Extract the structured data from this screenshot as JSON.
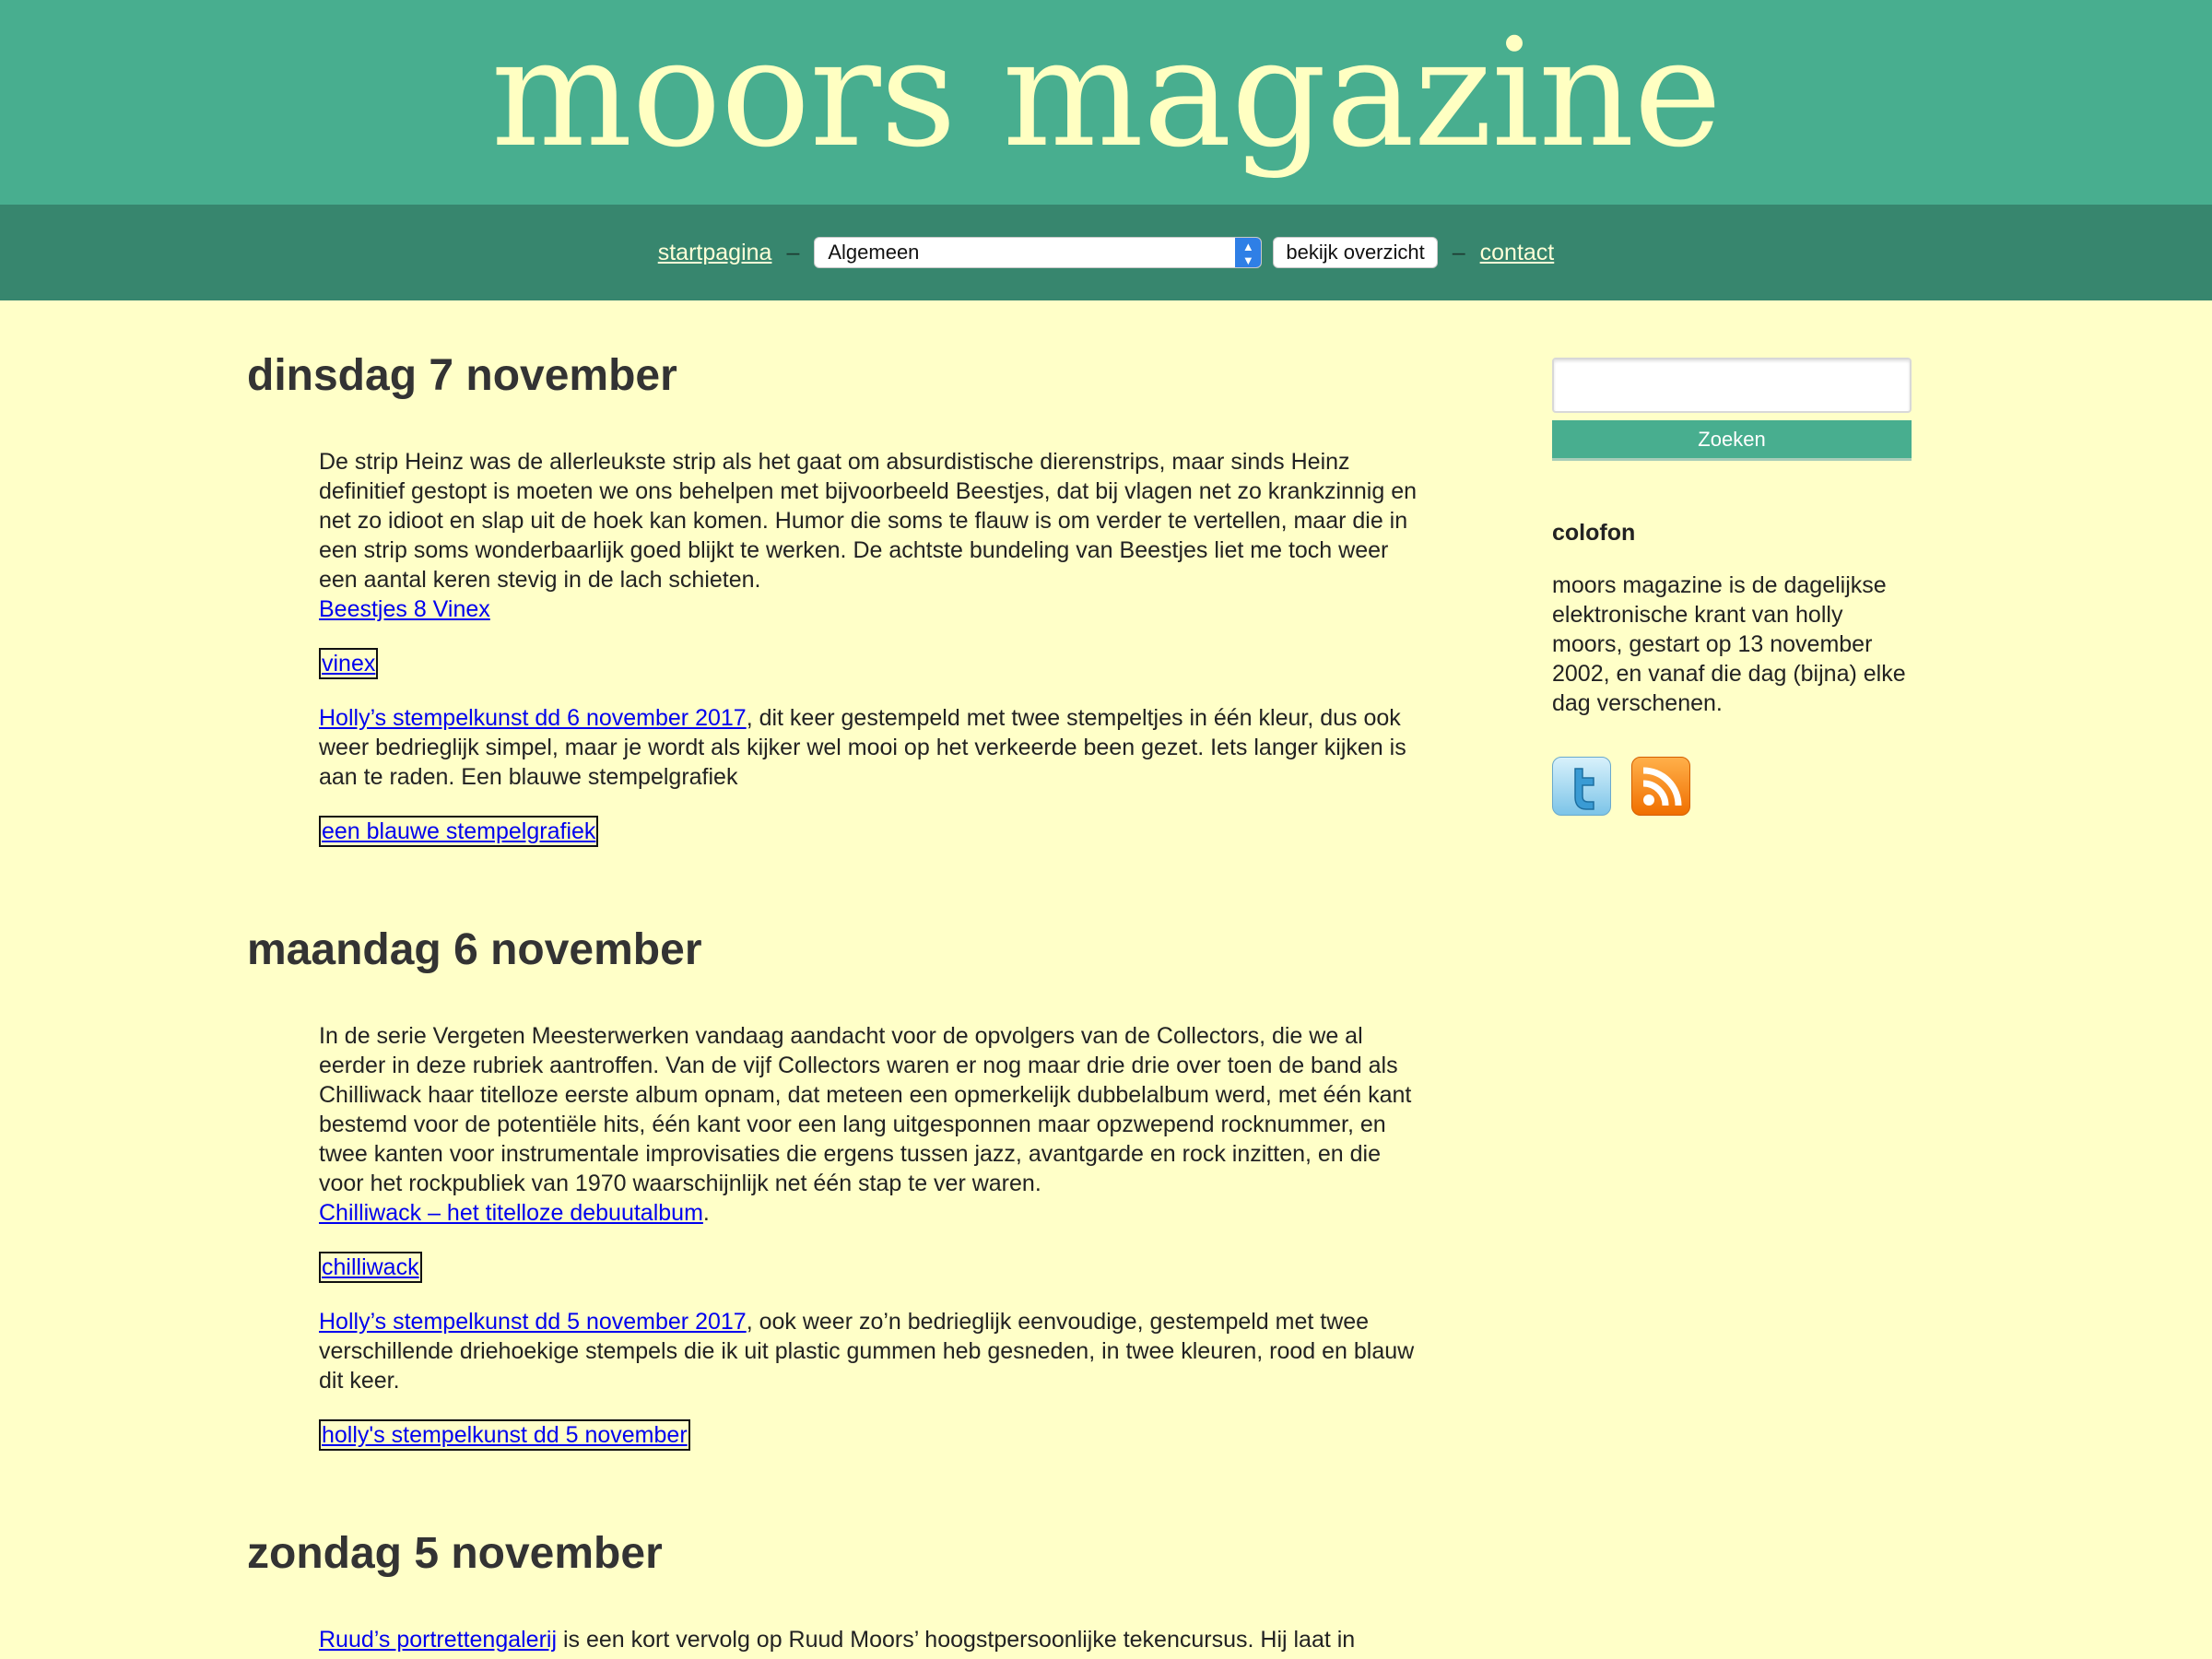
{
  "header": {
    "title": "moors magazine"
  },
  "nav": {
    "home": "startpagina",
    "dash": "–",
    "category_selected": "Algemeen",
    "overview_button": "bekijk overzicht",
    "contact": "contact"
  },
  "days": [
    {
      "date": "dinsdag 7 november",
      "p1": "De strip Heinz was de allerleukste strip als het gaat om absurdistische dierenstrips, maar sinds Heinz definitief gestopt is moeten we ons behelpen met bijvoorbeeld Beestjes, dat bij vlagen net zo krankzinnig en net zo idioot en slap uit de hoek kan komen. Humor die soms te flauw is om verder te vertellen, maar die in een strip soms wonderbaarlijk goed blijkt te werken. De achtste bundeling van Beestjes liet me toch weer een aantal keren stevig in de lach schieten.",
      "p1_link": "Beestjes 8 Vinex",
      "img1_label": "vinex",
      "p2_link": "Holly’s stempelkunst dd 6 november 2017",
      "p2_text": ", dit keer gestempeld met twee stempeltjes in één kleur, dus ook weer bedrieglijk simpel, maar je wordt als kijker wel mooi op het verkeerde been gezet. Iets langer kijken is aan te raden. Een blauwe stempelgrafiek",
      "img2_label": "een blauwe stempelgrafiek"
    },
    {
      "date": "maandag 6 november",
      "p1": "In de serie Vergeten Meesterwerken vandaag aandacht voor de opvolgers van de Collectors, die we al eerder in deze rubriek aantroffen. Van de vijf Collectors waren er nog maar drie drie over toen de band als Chilliwack haar titelloze eerste album opnam, dat meteen een opmerkelijk dubbelalbum werd, met één kant bestemd voor de potentiële hits, één kant voor een lang uitgesponnen maar opzwepend rocknummer, en twee kanten voor instrumentale improvisaties die ergens tussen jazz, avantgarde en rock inzitten, en die voor het rockpubliek van 1970 waarschijnlijk net één stap te ver waren.",
      "p1_link": "Chilliwack – het titelloze debuutalbum",
      "p1_link_suffix": ".",
      "img1_label": "chilliwack",
      "p2_link": "Holly’s stempelkunst dd 5 november 2017",
      "p2_text": ", ook weer zo’n bedrieglijk eenvoudige, gestempeld met twee verschillende driehoekige stempels die ik uit plastic gummen heb gesneden, in twee kleuren, rood en blauw dit keer.",
      "img2_label": "holly's stempelkunst dd 5 november"
    },
    {
      "date": "zondag 5 november",
      "p1_link": "Ruud’s portrettengalerij",
      "p1": " is een kort vervolg op Ruud Moors’ hoogstpersoonlijke tekencursus. Hij laat in"
    }
  ],
  "sidebar": {
    "search_button": "Zoeken",
    "colofon_title": "colofon",
    "colofon_text": "moors magazine is de dagelijkse elektronische krant van holly moors, gestart op 13 november 2002, en vanaf die dag (bijna) elke dag verschenen."
  },
  "icons": [
    "twitter-icon",
    "rss-icon",
    "chevron-updown-icon"
  ],
  "colors": {
    "header": "#48ae8f",
    "nav": "#37866e",
    "background": "#ffffc8",
    "title": "#ffffc2",
    "link": "#0000ee"
  }
}
